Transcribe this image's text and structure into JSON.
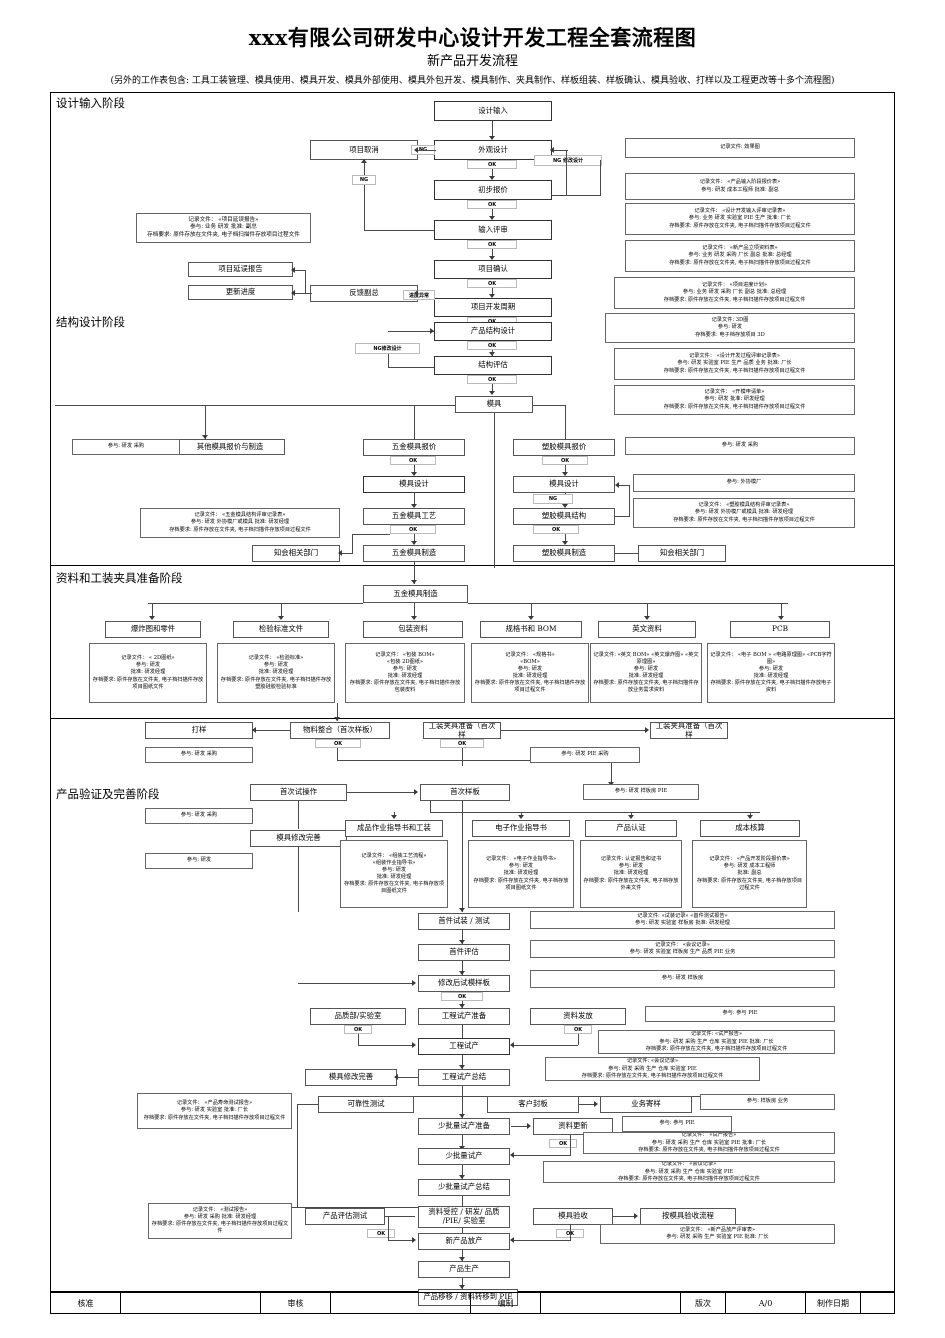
{
  "header": {
    "title": "xxx有限公司研发中心设计开发工程全套流程图",
    "subtitle": "新产品开发流程",
    "note": "(另外的工作表包含: 工具工装管理、模具使用、模具开发、模具外部使用、模具外包开发、模具制作、夹具制作、样板组装、样板确认、模具验收、打样以及工程更改等十多个流程图)"
  },
  "stages": {
    "s1": "设计输入阶段",
    "s2": "结构设计阶段",
    "s3": "资料和工装夹具准备阶段",
    "s4": "产品验证及完善阶段"
  },
  "gates": {
    "ok": "OK",
    "ng": "NG"
  },
  "nodes": {
    "design_input": "设计输入",
    "appearance_design": "外观设计",
    "project_cancel": "项目取消",
    "preliminary_quote": "初步报价",
    "input_review": "输入评审",
    "project_confirm": "项目确认",
    "project_dev_cycle": "项目开发周期",
    "project_delay_report": "项目延误报告",
    "update_progress": "更新进度",
    "feedback_vp": "反馈副总",
    "progress_abnormal": "进度异常",
    "modify_design": "NG 修改设计",
    "ng_structure_redesign": "NG修改设计",
    "product_structure_design": "产品结构设计",
    "structure_eval": "结构评估",
    "mold": "模具",
    "other_mold_quote_make": "其他模具报价与制造",
    "hw_mold_quote": "五金模具报价",
    "plastic_mold_quote": "塑胶模具报价",
    "mold_design_l": "模具设计",
    "mold_design_r": "模具设计",
    "hw_mold_process": "五金模具工艺",
    "plastic_mold_structure": "塑胶模具结构",
    "hw_mold_manufacture": "五金模具制造",
    "plastic_mold_manufacture": "塑胶模具制造",
    "notify_dept_l": "知会相关部门",
    "notify_dept_r": "知会相关部门",
    "hw_mold_manufacture2": "五金模具制造",
    "explode_parts": "爆炸图和零件",
    "inspect_standard": "检验标准文件",
    "packaging_data": "包装资料",
    "spec_bom": "规格书和 BOM",
    "english_data": "英文资料",
    "pcb": "PCB",
    "sampling": "打样",
    "material_gather": "物料整合（首次样板）",
    "fixture_prep_l": "工装夹具准备（首次样",
    "fixture_prep_r": "工装夹具准备（首次样",
    "first_trial_op": "首次试操作",
    "first_sample": "首次样板",
    "mold_modify_improve": "模具修改完善",
    "finished_sop_fixture": "成品作业指导书和工装",
    "electronic_sop": "电子作业指导书",
    "product_cert": "产品认证",
    "cost_accounting": "成本核算",
    "first_article_assy_test": "首件试装 / 测试",
    "first_article_eval": "首件评估",
    "modified_trial_sample": "修改后试模样板",
    "quality_lab": "品质部/实验室",
    "eng_trial_prep": "工程试产准备",
    "data_release": "资料发放",
    "eng_trial": "工程试产",
    "eng_trial_summary": "工程试产总结",
    "mold_modify_improve2": "模具修改完善",
    "reliability_test": "可靠性测试",
    "customer_sample": "客户封板",
    "business_send_sample": "业务寄样",
    "small_batch_prep": "少批量试产准备",
    "data_update": "资料更新",
    "small_batch_trial": "少批量试产",
    "small_batch_summary": "少批量试产总结",
    "product_eval_test": "产品评估测试",
    "data_control": "资料受控 / 研发/ 品质 /PIE/ 实验室",
    "mold_acceptance": "模具验收",
    "by_mold_acceptance_flow": "按模具验收流程",
    "new_product_release": "新产品放产",
    "mass_production": "产品生产",
    "product_transfer": "产品移移 / 资料转移到 PIE"
  },
  "annotations": {
    "a_delay_report": "记录文件： «项目延误报告»\n参与: 业务 研发      批准: 副总\n存档要求: 原件存放在文件夹, 电子档扫描件存放项目过程文件",
    "a_effect_pic": "记录文件: 效果图",
    "a_input_quote": "记录文件： «产品输入阶段报价表»\n参与: 研发    成本工程师    批准: 副总",
    "a_dev_input_review": "记录文件： «设计开发输入评审记录表»\n参与: 业务   研发   实验室   PIE   生产   批准: 厂长\n存档要求: 原件存放在文件夹, 电子档扫描件存放项目过程文件",
    "a_new_product_case": "记录文件： «新产品立项资料表»\n参与: 业务   研发   采购   厂长   副总   批准: 总经理\n存档要求: 原件存放在文件夹, 电子档扫描件存放项目过程文件",
    "a_project_schedule": "记录文件： «项目进度计划»\n参与: 业务   研发   采购   厂长   副总   批准: 总经理\n存档要求: 原件存放在文件夹, 电子档扫描件存放项目过程文件",
    "a_3d": "记录文件:      3D图\n参与: 研发\n存档要求: 电子档存放项目        3D",
    "a_process_review": "记录文件： «设计开发过程评审记录表»\n参与: 研发   实验室   PIE   生产   品质   业务   批准: 厂长\n存档要求: 原件存放在文件夹, 电子档扫描件存放项目过程文件",
    "a_open_mold_apply": "记录文件： «开模申请单»\n参与: 研发        批准: 研发经理\n存档要求: 原件存放在文件夹, 电子档扫描件存放项目过程文件",
    "a_rd_purchase_1": "参与: 研发   采购",
    "a_rd_purchase_2": "参与: 研发   采购",
    "a_outsource_mold": "参与: 外协模厂",
    "a_hw_mold_review": "记录文件： «五金模具结构评审记录表»\n参与: 研发   外协模厂或模具        批准: 研发经理\n存档要求: 原件存放在文件夹, 电子档扫描件存放项目过程文件",
    "a_plastic_mold_review": "记录文件： «塑胶模具结构评审记录表»\n参与: 研发   外协模厂或模具       批准: 研发经理\n存档要求: 原件存放在文件夹, 电子档扫描件存放项目过程文件",
    "a_2d_drawing": "记录文件： «  2D图纸»\n参与: 研发\n批准: 研发经理\n存档要求: 原件存放在文件夹, 电子档扫描件存放项目图纸文件",
    "a_inspect_std": "记录文件： «检验标准»\n参与: 研发\n批准: 研发经理\n存档要求: 原件存放在文件夹, 电子档扫描件存放塑胶硅胶检验标准",
    "a_packaging": "记录文件： «包装  BOM»\n«包装  2D图纸»\n参与: 研发\n批准: 研发经理\n存档要求: 原件存放在文件夹, 电子档扫描件存放包装皮料",
    "a_spec_bom": "记录文件： «规格书»\n«BOM»\n参与: 研发\n批准: 研发经理\n存档要求: 原件存放在文件夹, 电子档扫描件存放项目过程文件",
    "a_english": "记录文件: «英文  BOM» «英文爆炸图» «英文原理图»\n参与: 研发\n批准: 研发经理\n存档要求: 原件存放在文件夹, 电子档扫描件存放业务需求资料",
    "a_pcb": "记录文件： «电子  BOM » «电路原理图» «PCB字符图»\n参与: 研发\n批准: 研发经理\n存档要求: 原件存放在文件夹, 电子档扫描件存放电子资料",
    "a_rd_purchase_3": "参与: 研发   采购",
    "a_rd_pie_purchase": "参与: 研发   PIE   采购",
    "a_rd_purchase_4": "参与: 研发   采购",
    "a_rd_only": "参与: 研发",
    "a_rd_sample_pie": "参与: 研发   样板房   PIE",
    "a_assy_process": "记录文件： «组装工艺流程»\n«组装作业指导书»\n参与: 研发\n批准: 研发经理\n存档要求: 原件存放在文件夹, 电子档存放项目图纸文件",
    "a_electronic_sop": "记录文件： «电子作业指导书»\n参与: 研发\n批准: 研发经理\n存档要求: 原件存放在文件夹, 电子档存放项目图纸文件",
    "a_cert": "记录文件: 认证报告和证书\n参与: 研发\n批准: 研发经理\n存档要求: 原件存放在文件夹, 电子档存放外来文件",
    "a_cost": "记录文件：    «产品开发阶段报价表»\n参与: 研发      成本工程师\n批准: 副总\n存档要求: 原件存放在文件夹, 电子档存放项目过程文件",
    "a_trial_record": "记录文件: «试装记录» «首件测试报告»\n参与: 研发   实验室   样板房   批准: 研发经理",
    "a_meeting_record1": "记录文件： «会议记录»\n参与: 研发   实验室   样板房   生产   品质   PIE   业务",
    "a_rd_sample": "参与: 研发   样板房",
    "a_trial_report1": "记录文件: «试产报告»\n参与: 研发   采购   生产   仓库   实验室   PIE   批准: 厂长\n存档要求: 原件存放在文件夹, 电子档扫描件存放项目过程文件",
    "a_meeting_record2": "记录文件: «会议记录»\n参与: 研发   采购   生产   仓库   实验室   PIE\n存档要求: 原件存放在文件夹, 电子档扫描件存放项目过程文件",
    "a_life_test": "记录文件： «产品寿命测试报告»\n参与: 研发   实验室   批准: 厂长\n存档要求: 原件存放在文件夹, 电子档扫描件存放项目过程文件",
    "a_sample_business": "参与: 样板房   业务",
    "a_rd_pie": "参与: 参与   PIE",
    "a_trial_report2": "记录文件： «试产报告»\n参与: 研发   采购   生产   仓库   实验室   PIE   批准: 厂长\n存档要求: 原件存放在文件夹, 电子档扫描件存放项目过程文件",
    "a_meeting_record3": "记录文件： «会议记录»\n参与: 研发   采购   生产   仓库   实验室   PIE\n存档要求: 原件存放在文件夹, 电子档扫描件存放项目过程文件",
    "a_test_report": "记录文件：  «测试报告»\n参与: 研发   采购   批准: 研发经理\n存档要求: 原件存放在文件夹, 电子档扫描件存放项目过程文件",
    "a_new_prod_review": "记录文件： «新产品放产评审表»\n参与: 研发   采购   生产   实验室   PIE   批准: 厂长"
  },
  "footer": {
    "approve_label": "核准",
    "approve_value": "",
    "review_label": "审核",
    "review_value": "",
    "compile_label": "编制",
    "compile_value": "",
    "version_label": "版次",
    "version_value": "A/0",
    "date_label": "制作日期",
    "date_value": ""
  }
}
